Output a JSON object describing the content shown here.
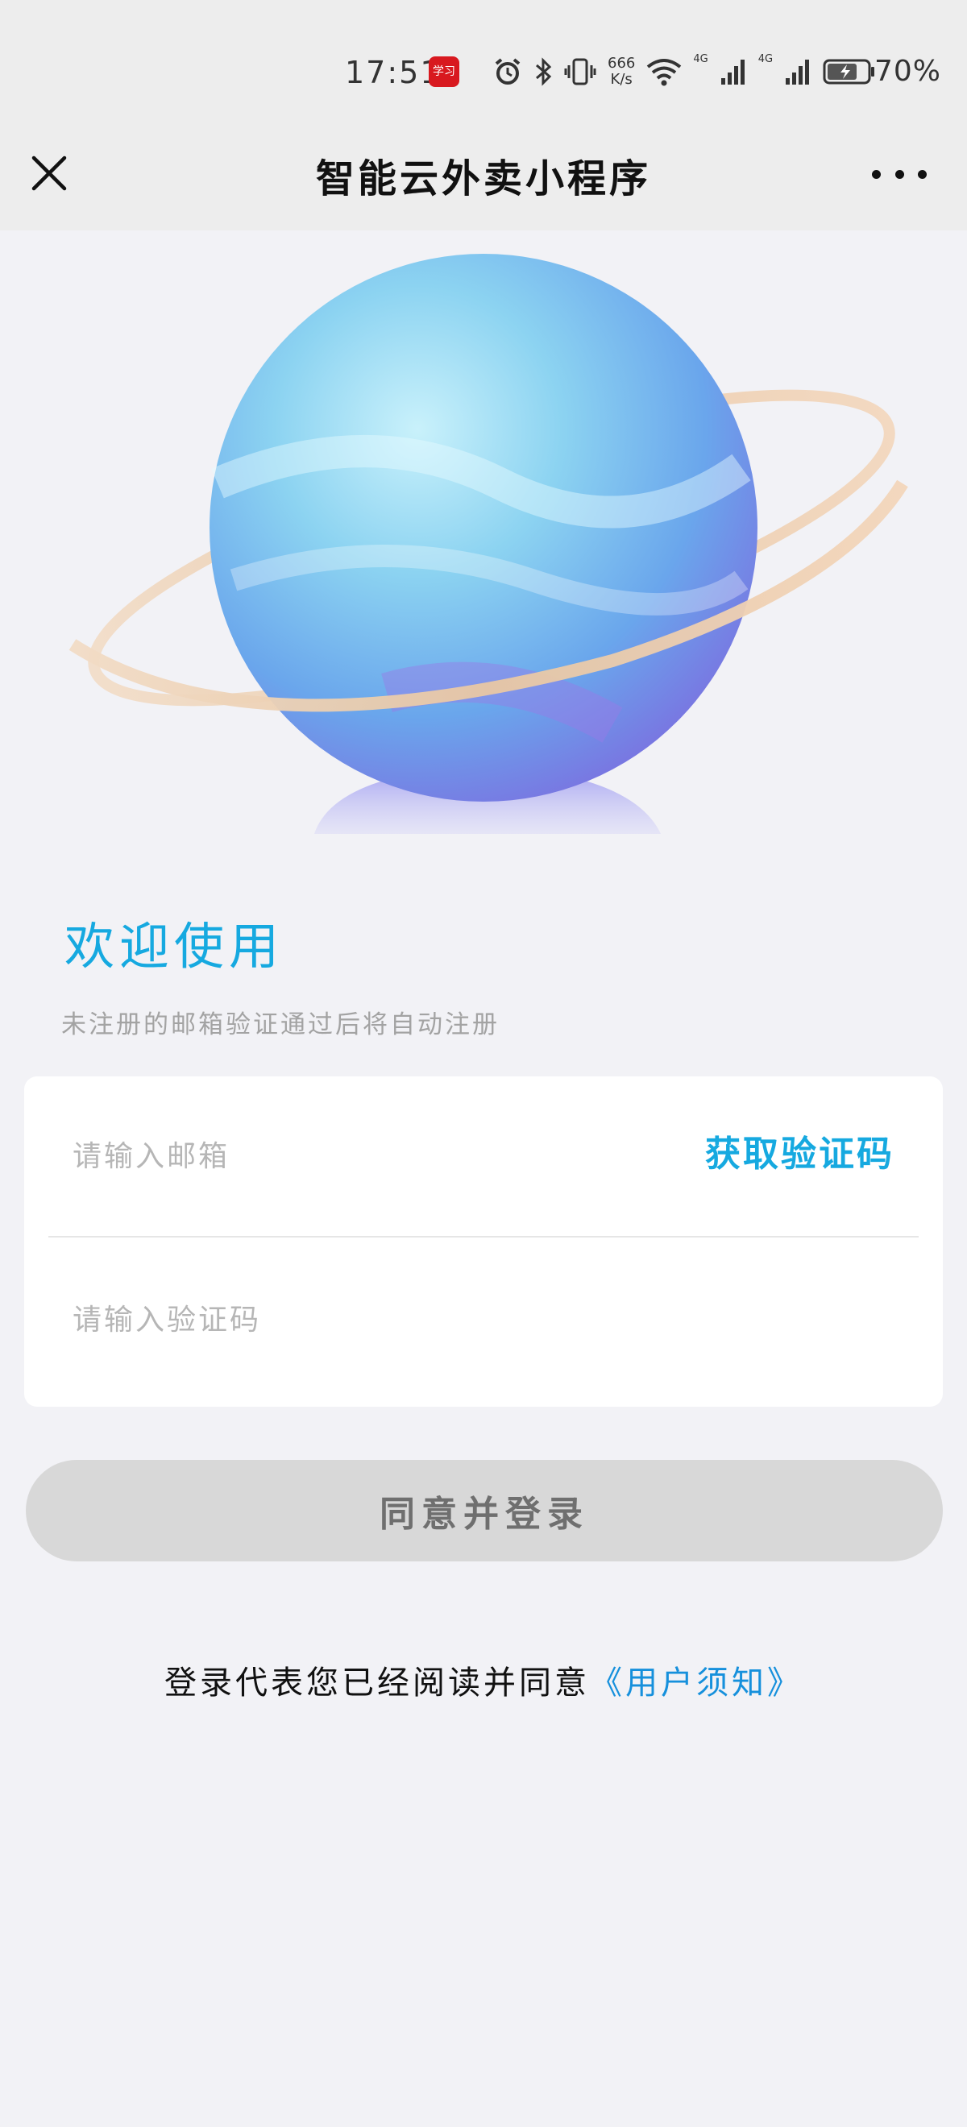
{
  "status_bar": {
    "time": "17:51",
    "app_badge": "学习",
    "net_speed_value": "666",
    "net_speed_unit": "K/s",
    "net_label_1": "4G",
    "net_label_2": "4G",
    "battery": "70%",
    "icons": [
      "alarm-icon",
      "bluetooth-icon",
      "vibrate-icon",
      "wifi-icon",
      "signal-icon",
      "signal-icon",
      "battery-icon"
    ]
  },
  "nav": {
    "title": "智能云外卖小程序",
    "close_icon": "close-icon",
    "more_icon": "more-icon"
  },
  "welcome": {
    "title": "欢迎使用",
    "subtitle": "未注册的邮箱验证通过后将自动注册"
  },
  "form": {
    "email_placeholder": "请输入邮箱",
    "email_value": "",
    "get_code_label": "获取验证码",
    "code_placeholder": "请输入验证码",
    "code_value": ""
  },
  "login_button": {
    "label": "同意并登录"
  },
  "agreement": {
    "text": "登录代表您已经阅读并同意",
    "link": "《用户须知》"
  },
  "colors": {
    "accent": "#16a9e0",
    "link": "#1690dc",
    "button_disabled": "#d8d8d8",
    "background": "#f2f2f6"
  }
}
